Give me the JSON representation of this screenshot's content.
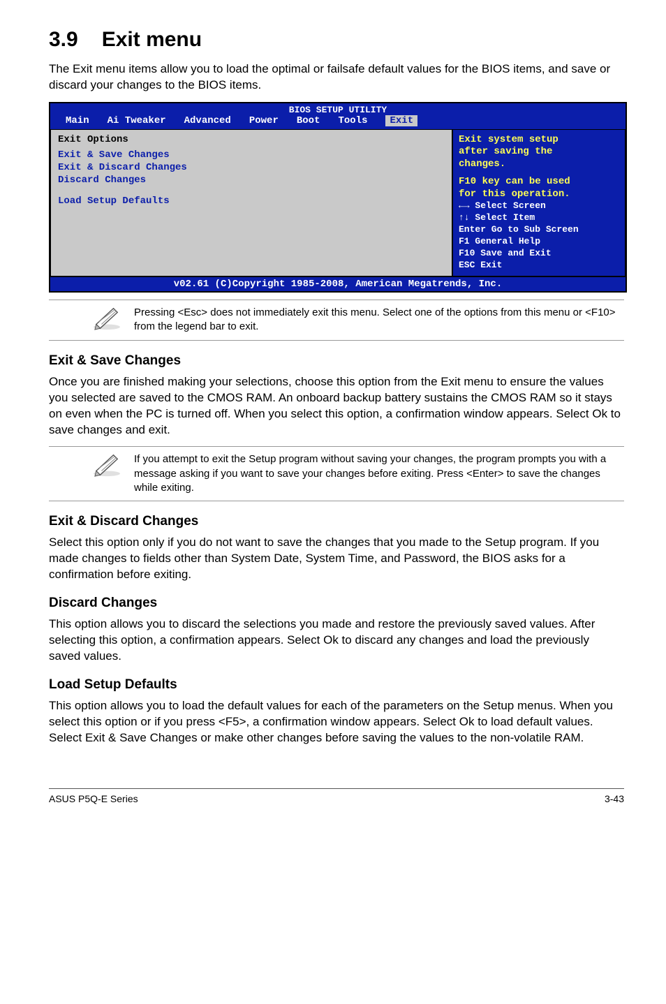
{
  "section": {
    "number": "3.9",
    "title": "Exit menu"
  },
  "intro": "The Exit menu items allow you to load the optimal or failsafe default values for the BIOS items, and save or discard your changes to the BIOS items.",
  "bios": {
    "header": "BIOS SETUP UTILITY",
    "tabs": [
      "Main",
      "Ai Tweaker",
      "Advanced",
      "Power",
      "Boot",
      "Tools",
      "Exit"
    ],
    "left_title": "Exit Options",
    "items": [
      "Exit & Save Changes",
      "Exit & Discard Changes",
      "Discard Changes",
      "Load Setup Defaults"
    ],
    "help": {
      "l1": "Exit system setup",
      "l2": "after saving the",
      "l3": "changes.",
      "l4": "F10 key can be used",
      "l5": "for this operation."
    },
    "nav": {
      "l1": "←→   Select Screen",
      "l2": "↑↓   Select Item",
      "l3": "Enter Go to Sub Screen",
      "l4": "F1   General Help",
      "l5": "F10  Save and Exit",
      "l6": "ESC  Exit"
    },
    "footer": "v02.61 (C)Copyright 1985-2008, American Megatrends, Inc."
  },
  "note1": "Pressing <Esc> does not immediately exit this menu. Select one of the options from this menu or <F10> from the legend bar to exit.",
  "save": {
    "heading": "Exit & Save Changes",
    "body": "Once you are finished making your selections, choose this option from the Exit menu to ensure the values you selected are saved to the CMOS RAM. An onboard backup battery sustains the CMOS RAM so it stays on even when the PC is turned off. When you select this option, a confirmation window appears. Select Ok to save changes and exit."
  },
  "note2": "If you attempt to exit the Setup program without saving your changes, the program prompts you with a message asking if you want to save your changes before exiting. Press <Enter> to save the changes while exiting.",
  "discardexit": {
    "heading": "Exit & Discard Changes",
    "body": "Select this option only if you do not want to save the changes that you  made to the Setup program. If you made changes to fields other than System Date, System Time, and Password, the BIOS asks for a confirmation before exiting."
  },
  "discard": {
    "heading": "Discard Changes",
    "body": "This option allows you to discard the selections you made and restore the previously saved values. After selecting this option, a confirmation appears. Select Ok to discard any changes and load the previously saved values."
  },
  "load": {
    "heading": "Load Setup Defaults",
    "body": "This option allows you to load the default values for each of the parameters on the Setup menus. When you select this option or if you press <F5>, a confirmation window appears. Select Ok to load default values. Select Exit & Save Changes or make other changes before saving the values to the non-volatile RAM."
  },
  "footer": {
    "left": "ASUS P5Q-E Series",
    "right": "3-43"
  }
}
